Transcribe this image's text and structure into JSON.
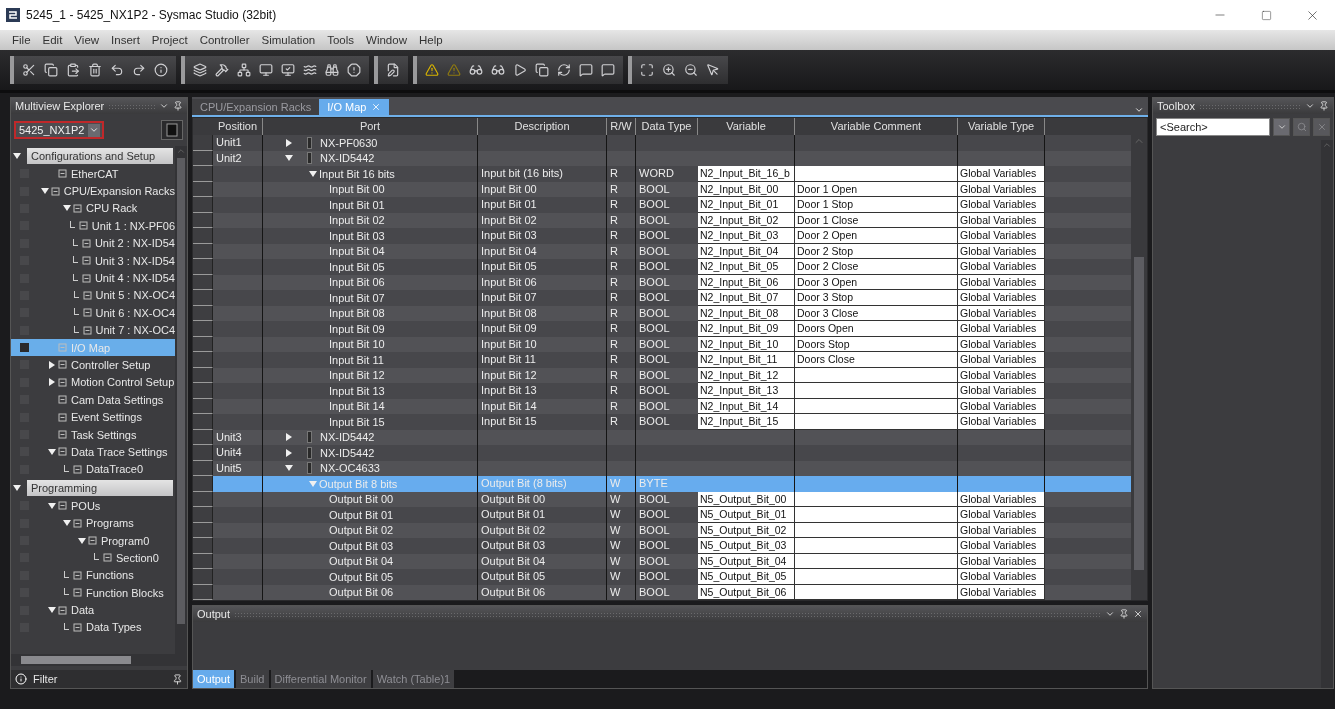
{
  "window": {
    "title": "5245_1 - 5425_NX1P2 - Sysmac Studio (32bit)"
  },
  "menu": [
    "File",
    "Edit",
    "View",
    "Insert",
    "Project",
    "Controller",
    "Simulation",
    "Tools",
    "Window",
    "Help"
  ],
  "sidebar": {
    "title": "Multiview Explorer",
    "device": "5425_NX1P2",
    "filter": "Filter",
    "sections": [
      {
        "label": "Configurations and Setup",
        "expanded": true,
        "items": [
          {
            "label": "EtherCAT",
            "selected": false
          },
          {
            "label": "CPU/Expansion Racks",
            "selected": false,
            "expanded": true,
            "children": [
              {
                "label": "CPU Rack",
                "selected": false,
                "expanded": true,
                "children": [
                  {
                    "label": "Unit 1 : NX-PF06",
                    "selected": false
                  },
                  {
                    "label": "Unit 2 : NX-ID54",
                    "selected": false
                  },
                  {
                    "label": "Unit 3 : NX-ID54",
                    "selected": false
                  },
                  {
                    "label": "Unit 4 : NX-ID54",
                    "selected": false
                  },
                  {
                    "label": "Unit 5 : NX-OC4",
                    "selected": false
                  },
                  {
                    "label": "Unit 6 : NX-OC4",
                    "selected": false
                  },
                  {
                    "label": "Unit 7 : NX-OC4",
                    "selected": false
                  }
                ]
              }
            ]
          },
          {
            "label": "I/O Map",
            "selected": true
          },
          {
            "label": "Controller Setup",
            "selected": false,
            "expanded": false
          },
          {
            "label": "Motion Control Setup",
            "selected": false,
            "expanded": false
          },
          {
            "label": "Cam Data Settings",
            "selected": false
          },
          {
            "label": "Event Settings",
            "selected": false
          },
          {
            "label": "Task Settings",
            "selected": false
          },
          {
            "label": "Data Trace Settings",
            "selected": false,
            "expanded": true,
            "children": [
              {
                "label": "DataTrace0",
                "selected": false
              }
            ]
          }
        ]
      },
      {
        "label": "Programming",
        "expanded": true,
        "items": [
          {
            "label": "POUs",
            "selected": false,
            "expanded": true,
            "children": [
              {
                "label": "Programs",
                "selected": false,
                "expanded": true,
                "children": [
                  {
                    "label": "Program0",
                    "selected": false,
                    "expanded": true,
                    "children": [
                      {
                        "label": "Section0",
                        "selected": false
                      }
                    ]
                  }
                ]
              },
              {
                "label": "Functions",
                "selected": false
              },
              {
                "label": "Function Blocks",
                "selected": false
              }
            ]
          },
          {
            "label": "Data",
            "selected": false,
            "expanded": true,
            "children": [
              {
                "label": "Data Types",
                "selected": false
              }
            ]
          }
        ]
      }
    ]
  },
  "tabs": [
    {
      "label": "CPU/Expansion Racks",
      "selected": false
    },
    {
      "label": "I/O Map",
      "selected": true
    }
  ],
  "table": {
    "columns": [
      "Position",
      "Port",
      "Description",
      "R/W",
      "Data Type",
      "Variable",
      "Variable Comment",
      "Variable Type"
    ],
    "rows": [
      {
        "position": "Unit1",
        "port": "NX-PF0630",
        "expanded": false,
        "selected": false
      },
      {
        "position": "Unit2",
        "port": "NX-ID5442",
        "expanded": true,
        "selected": false,
        "children": [
          {
            "port": "Input Bit 16 bits",
            "description": "Input bit (16 bits)",
            "rw": "R",
            "data_type": "WORD",
            "variable": "N2_Input_Bit_16_b",
            "variable_type": "Global Variables",
            "expanded": true,
            "selected": false,
            "children": [
              {
                "port": "Input Bit 00",
                "description": "Input Bit 00",
                "rw": "R",
                "data_type": "BOOL",
                "variable": "N2_Input_Bit_00",
                "variable_comment": "Door 1 Open",
                "variable_type": "Global Variables",
                "selected": false
              },
              {
                "port": "Input Bit 01",
                "description": "Input Bit 01",
                "rw": "R",
                "data_type": "BOOL",
                "variable": "N2_Input_Bit_01",
                "variable_comment": "Door 1 Stop",
                "variable_type": "Global Variables",
                "selected": false
              },
              {
                "port": "Input Bit 02",
                "description": "Input Bit 02",
                "rw": "R",
                "data_type": "BOOL",
                "variable": "N2_Input_Bit_02",
                "variable_comment": "Door 1 Close",
                "variable_type": "Global Variables",
                "selected": false
              },
              {
                "port": "Input Bit 03",
                "description": "Input Bit 03",
                "rw": "R",
                "data_type": "BOOL",
                "variable": "N2_Input_Bit_03",
                "variable_comment": "Door 2 Open",
                "variable_type": "Global Variables",
                "selected": false
              },
              {
                "port": "Input Bit 04",
                "description": "Input Bit 04",
                "rw": "R",
                "data_type": "BOOL",
                "variable": "N2_Input_Bit_04",
                "variable_comment": "Door 2 Stop",
                "variable_type": "Global Variables",
                "selected": false
              },
              {
                "port": "Input Bit 05",
                "description": "Input Bit 05",
                "rw": "R",
                "data_type": "BOOL",
                "variable": "N2_Input_Bit_05",
                "variable_comment": "Door 2 Close",
                "variable_type": "Global Variables",
                "selected": false
              },
              {
                "port": "Input Bit 06",
                "description": "Input Bit 06",
                "rw": "R",
                "data_type": "BOOL",
                "variable": "N2_Input_Bit_06",
                "variable_comment": "Door 3 Open",
                "variable_type": "Global Variables",
                "selected": false
              },
              {
                "port": "Input Bit 07",
                "description": "Input Bit 07",
                "rw": "R",
                "data_type": "BOOL",
                "variable": "N2_Input_Bit_07",
                "variable_comment": "Door 3 Stop",
                "variable_type": "Global Variables",
                "selected": false
              },
              {
                "port": "Input Bit 08",
                "description": "Input Bit 08",
                "rw": "R",
                "data_type": "BOOL",
                "variable": "N2_Input_Bit_08",
                "variable_comment": "Door 3 Close",
                "variable_type": "Global Variables",
                "selected": false
              },
              {
                "port": "Input Bit 09",
                "description": "Input Bit 09",
                "rw": "R",
                "data_type": "BOOL",
                "variable": "N2_Input_Bit_09",
                "variable_comment": "Doors Open",
                "variable_type": "Global Variables",
                "selected": false
              },
              {
                "port": "Input Bit 10",
                "description": "Input Bit 10",
                "rw": "R",
                "data_type": "BOOL",
                "variable": "N2_Input_Bit_10",
                "variable_comment": "Doors Stop",
                "variable_type": "Global Variables",
                "selected": false
              },
              {
                "port": "Input Bit 11",
                "description": "Input Bit 11",
                "rw": "R",
                "data_type": "BOOL",
                "variable": "N2_Input_Bit_11",
                "variable_comment": "Doors Close",
                "variable_type": "Global Variables",
                "selected": false
              },
              {
                "port": "Input Bit 12",
                "description": "Input Bit 12",
                "rw": "R",
                "data_type": "BOOL",
                "variable": "N2_Input_Bit_12",
                "variable_type": "Global Variables",
                "selected": false
              },
              {
                "port": "Input Bit 13",
                "description": "Input Bit 13",
                "rw": "R",
                "data_type": "BOOL",
                "variable": "N2_Input_Bit_13",
                "variable_type": "Global Variables",
                "selected": false
              },
              {
                "port": "Input Bit 14",
                "description": "Input Bit 14",
                "rw": "R",
                "data_type": "BOOL",
                "variable": "N2_Input_Bit_14",
                "variable_type": "Global Variables",
                "selected": false
              },
              {
                "port": "Input Bit 15",
                "description": "Input Bit 15",
                "rw": "R",
                "data_type": "BOOL",
                "variable": "N2_Input_Bit_15",
                "variable_type": "Global Variables",
                "selected": false
              }
            ]
          }
        ]
      },
      {
        "position": "Unit3",
        "port": "NX-ID5442",
        "expanded": false,
        "selected": false
      },
      {
        "position": "Unit4",
        "port": "NX-ID5442",
        "expanded": false,
        "selected": false
      },
      {
        "position": "Unit5",
        "port": "NX-OC4633",
        "expanded": true,
        "selected": false,
        "children": [
          {
            "port": "Output Bit 8 bits",
            "description": "Output Bit (8 bits)",
            "rw": "W",
            "data_type": "BYTE",
            "expanded": true,
            "selected": true,
            "children": [
              {
                "port": "Output Bit 00",
                "description": "Output Bit 00",
                "rw": "W",
                "data_type": "BOOL",
                "variable": "N5_Output_Bit_00",
                "variable_type": "Global Variables",
                "selected": false
              },
              {
                "port": "Output Bit 01",
                "description": "Output Bit 01",
                "rw": "W",
                "data_type": "BOOL",
                "variable": "N5_Output_Bit_01",
                "variable_type": "Global Variables",
                "selected": false
              },
              {
                "port": "Output Bit 02",
                "description": "Output Bit 02",
                "rw": "W",
                "data_type": "BOOL",
                "variable": "N5_Output_Bit_02",
                "variable_type": "Global Variables",
                "selected": false
              },
              {
                "port": "Output Bit 03",
                "description": "Output Bit 03",
                "rw": "W",
                "data_type": "BOOL",
                "variable": "N5_Output_Bit_03",
                "variable_type": "Global Variables",
                "selected": false
              },
              {
                "port": "Output Bit 04",
                "description": "Output Bit 04",
                "rw": "W",
                "data_type": "BOOL",
                "variable": "N5_Output_Bit_04",
                "variable_type": "Global Variables",
                "selected": false
              },
              {
                "port": "Output Bit 05",
                "description": "Output Bit 05",
                "rw": "W",
                "data_type": "BOOL",
                "variable": "N5_Output_Bit_05",
                "variable_type": "Global Variables",
                "selected": false
              },
              {
                "port": "Output Bit 06",
                "description": "Output Bit 06",
                "rw": "W",
                "data_type": "BOOL",
                "variable": "N5_Output_Bit_06",
                "variable_type": "Global Variables",
                "selected": false
              }
            ]
          }
        ]
      }
    ]
  },
  "output": {
    "title": "Output",
    "tabs": [
      {
        "label": "Output",
        "selected": true
      },
      {
        "label": "Build",
        "selected": false
      },
      {
        "label": "Differential Monitor",
        "selected": false
      },
      {
        "label": "Watch (Table)1",
        "selected": false
      }
    ]
  },
  "toolbox": {
    "title": "Toolbox",
    "search": {
      "placeholder": "<Search>"
    }
  }
}
